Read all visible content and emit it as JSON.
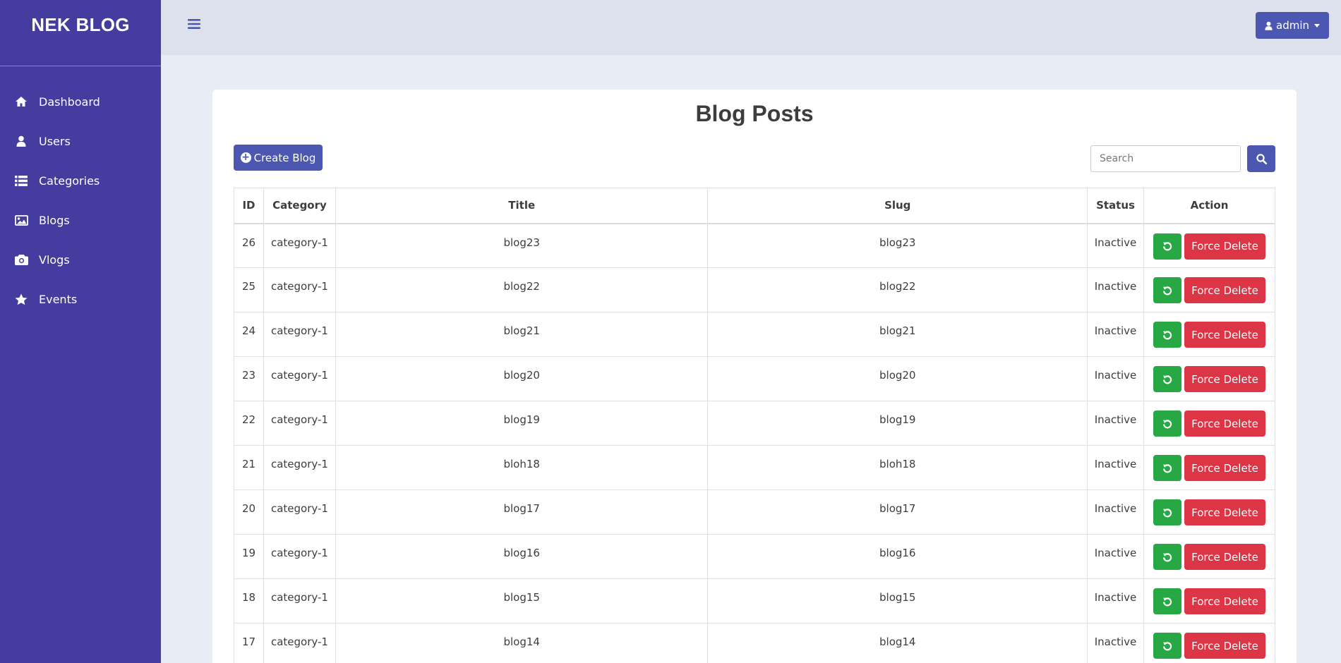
{
  "sidebar": {
    "brand": "NEK BLOG",
    "items": [
      {
        "label": "Dashboard",
        "icon": "home-icon"
      },
      {
        "label": "Users",
        "icon": "user-icon"
      },
      {
        "label": "Categories",
        "icon": "list-icon"
      },
      {
        "label": "Blogs",
        "icon": "image-icon"
      },
      {
        "label": "Vlogs",
        "icon": "camera-icon"
      },
      {
        "label": "Events",
        "icon": "star-icon"
      }
    ]
  },
  "topbar": {
    "menu_icon": "hamburger-icon",
    "user_label": "admin",
    "user_icon": "user-icon"
  },
  "main": {
    "title": "Blog Posts",
    "create_label": "Create Blog",
    "search_placeholder": "Search",
    "columns": [
      "ID",
      "Category",
      "Title",
      "Slug",
      "Status",
      "Action"
    ],
    "delete_label": "Force Delete",
    "rows": [
      {
        "id": "26",
        "category": "category-1",
        "title": "blog23",
        "slug": "blog23",
        "status": "Inactive"
      },
      {
        "id": "25",
        "category": "category-1",
        "title": "blog22",
        "slug": "blog22",
        "status": "Inactive"
      },
      {
        "id": "24",
        "category": "category-1",
        "title": "blog21",
        "slug": "blog21",
        "status": "Inactive"
      },
      {
        "id": "23",
        "category": "category-1",
        "title": "blog20",
        "slug": "blog20",
        "status": "Inactive"
      },
      {
        "id": "22",
        "category": "category-1",
        "title": "blog19",
        "slug": "blog19",
        "status": "Inactive"
      },
      {
        "id": "21",
        "category": "category-1",
        "title": "bloh18",
        "slug": "bloh18",
        "status": "Inactive"
      },
      {
        "id": "20",
        "category": "category-1",
        "title": "blog17",
        "slug": "blog17",
        "status": "Inactive"
      },
      {
        "id": "19",
        "category": "category-1",
        "title": "blog16",
        "slug": "blog16",
        "status": "Inactive"
      },
      {
        "id": "18",
        "category": "category-1",
        "title": "blog15",
        "slug": "blog15",
        "status": "Inactive"
      },
      {
        "id": "17",
        "category": "category-1",
        "title": "blog14",
        "slug": "blog14",
        "status": "Inactive"
      }
    ]
  },
  "colors": {
    "sidebar": "#453c9f",
    "primary": "#4b57b0",
    "success": "#28a845",
    "danger": "#dc3545",
    "background": "#e8ecf5",
    "topbar": "#dde1eb"
  }
}
